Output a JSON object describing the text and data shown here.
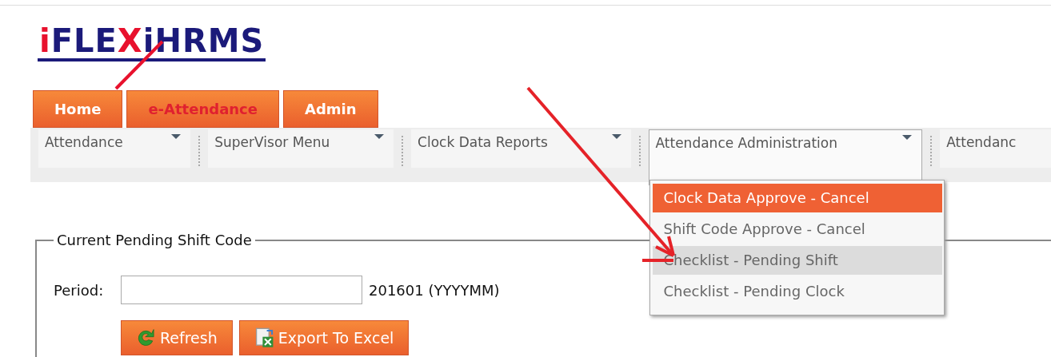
{
  "logo": {
    "parts": [
      {
        "text": "i",
        "color": "#e8112d"
      },
      {
        "text": "FLE",
        "color": "#1b1a7a"
      },
      {
        "text": "X",
        "color": "#e8112d"
      },
      {
        "text": "iHRMS",
        "color": "#1b1a7a"
      }
    ]
  },
  "tabs": [
    {
      "label": "Home",
      "selected": false
    },
    {
      "label": "e-Attendance",
      "selected": true
    },
    {
      "label": "Admin",
      "selected": false
    }
  ],
  "menus": [
    {
      "label": "Attendance",
      "expanded": false
    },
    {
      "label": "SuperVisor Menu",
      "expanded": false
    },
    {
      "label": "Clock Data Reports",
      "expanded": false
    },
    {
      "label": "Attendance Administration",
      "expanded": true,
      "items": [
        {
          "label": "Clock Data Approve - Cancel",
          "selected": true,
          "hovered": false
        },
        {
          "label": "Shift Code Approve - Cancel",
          "selected": false,
          "hovered": false
        },
        {
          "label": "Checklist - Pending Shift",
          "selected": false,
          "hovered": true
        },
        {
          "label": "Checklist - Pending Clock",
          "selected": false,
          "hovered": false
        }
      ]
    },
    {
      "label": "Attendanc",
      "expanded": false
    }
  ],
  "form": {
    "legend": "Current Pending Shift Code",
    "period_label": "Period:",
    "period_hint": "201601 (YYYYMM)",
    "buttons": [
      {
        "label": "Refresh",
        "kind": "refresh"
      },
      {
        "label": "Export To Excel",
        "kind": "excel"
      }
    ]
  }
}
